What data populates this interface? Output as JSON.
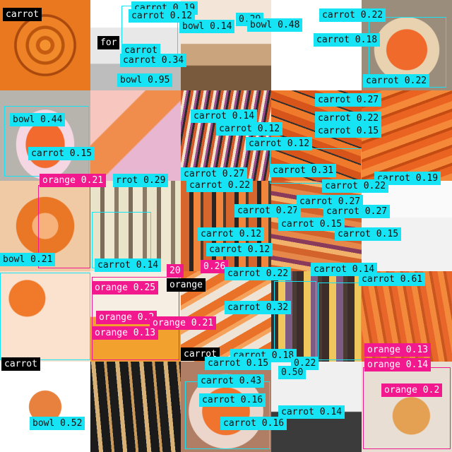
{
  "tiles": [
    {
      "name": "carrot-slices-tile",
      "bg": "radial-gradient(circle at 50% 50%, #f3922f 0 8%, #c85b12 9% 14%, #f08a2b 15% 25%, #b9540f 26% 30%, #ef8226 31% 44%, #a9490d 45% 48%, #e9781f 49% 100%)"
    },
    {
      "name": "cupcakes-tile",
      "bg": "linear-gradient(180deg,#f3e6d9 0 48%, #caa47c 49% 72%, #7a5a3c 73% 100%)"
    },
    {
      "name": "fork-tile",
      "bg": "linear-gradient(180deg,#ffffff 0 30%, #e8e8e8 31% 70%, #bdbdbd 71% 100%)"
    },
    {
      "name": "white-tile",
      "bg": "#ffffff"
    },
    {
      "name": "carrot-bowl-tile",
      "bg": "radial-gradient(circle at 50% 55%, #f06a2c 0 30%, #e8d2b0 31% 48%, #9a8d7b 49% 100%)"
    },
    {
      "name": "heart-bowl-tile",
      "bg": "radial-gradient(ellipse at 50% 60%, #f26a2d 0 30%, #f4d7e2 31% 45%, #b7b4ad 46% 100%)"
    },
    {
      "name": "lunchbox-tile",
      "bg": "linear-gradient(135deg,#f6c6bf 0 30%, #f08d4c 31% 55%, #e8b6d1 56% 100%)"
    },
    {
      "name": "julienne-tile",
      "bg": "repeating-linear-gradient(100deg,#d45a2a 0 4px,#f0e4cf 4px 8px,#9a4a8f 8px 11px,#2a2a2a 11px 14px)"
    },
    {
      "name": "carrot-pile-tile",
      "bg": "repeating-linear-gradient(20deg,#d7541b 0 10px,#f07a2b 10px 20px,#2f2f2f 20px 22px)"
    },
    {
      "name": "carrot-pile-right-tile",
      "bg": "repeating-linear-gradient(160deg,#ea6320 0 10px,#f5893a 10px 20px,#c44c12 20px 24px)"
    },
    {
      "name": "sliced-circle-tile",
      "bg": "radial-gradient(circle at 50% 50%, #f7b17a 0 20%, #e97725 21% 45%, #f0c9a5 46% 100%)"
    },
    {
      "name": "parsnip-tile",
      "bg": "repeating-linear-gradient(90deg,#e9e3c9 0 14px,#7c6b58 14px 20px,#efe7d0 20px 34px,#8a7a66 34px 40px)"
    },
    {
      "name": "grill-tile",
      "bg": "repeating-linear-gradient(90deg,#d6662b 0 12px,#2a2522 12px 18px,#f0853b 18px 28px,#4b3b2e 28px 32px)"
    },
    {
      "name": "mixed-carrots-tile",
      "bg": "repeating-linear-gradient(10deg,#d3632a 0 9px,#f2b16b 9px 16px,#8a3b5b 16px 22px,#e6884a 22px 30px)"
    },
    {
      "name": "hanging-carrots-tile",
      "bg": "linear-gradient(180deg,#fafafa 0 40%, #f2f2f2 41% 100%)"
    },
    {
      "name": "orange-slices-tile",
      "bg": "radial-gradient(circle at 30% 30%, #f0792a 0 20%, #fbe2cf 21% 100%)"
    },
    {
      "name": "carrot-juice-tile",
      "bg": "linear-gradient(180deg,#f6ede3 0 50%, #f2a12e 51% 100%)"
    },
    {
      "name": "cut-carrots-tile",
      "bg": "repeating-linear-gradient(150deg,#ea7128 0 12px,#f4a25c 12px 18px,#efe3d6 18px 30px)"
    },
    {
      "name": "purple-carrots-tile",
      "bg": "repeating-linear-gradient(90deg,#3d2d2a 0 10px,#f0c75c 10px 20px,#7d5b82 20px 30px,#4a3b35 30px 36px)"
    },
    {
      "name": "market-carrots-tile",
      "bg": "repeating-linear-gradient(80deg,#e9662a 0 8px,#f38a3b 8px 16px,#c9561f 16px 20px)"
    },
    {
      "name": "plate-tile",
      "bg": "radial-gradient(circle at 50% 50%, #e9813e 0 25%, #ffffff 26% 100%)"
    },
    {
      "name": "dark-carrots-tile",
      "bg": "repeating-linear-gradient(85deg,#1c1c1c 0 12px,#d8b177 12px 18px,#1a1a1a 18px 30px,#c99a5c 30px 34px)"
    },
    {
      "name": "bowl-carrots-tile",
      "bg": "radial-gradient(circle at 50% 55%, #f0742d 0 35%, #ecd6cc 36% 55%, #b07e64 56% 100%)"
    },
    {
      "name": "seedlings-tile",
      "bg": "linear-gradient(180deg,#f0f0f0 0 55%, #3b3b3b 56% 100%)"
    },
    {
      "name": "onion-tile",
      "bg": "radial-gradient(circle at 55% 60%, #e4a053 0 25%, #e8ded3 26% 100%)"
    }
  ],
  "boxes": [
    {
      "name": "detection-box",
      "c": "cyan"
    },
    {
      "name": "detection-box",
      "c": "cyan"
    },
    {
      "name": "detection-box",
      "c": "cyan"
    },
    {
      "name": "detection-box",
      "c": "cyan"
    },
    {
      "name": "detection-box",
      "c": "cyan"
    },
    {
      "name": "detection-box",
      "c": "cyan"
    },
    {
      "name": "detection-box",
      "c": "pink"
    },
    {
      "name": "detection-box",
      "c": "pink"
    },
    {
      "name": "detection-box",
      "c": "cyan"
    },
    {
      "name": "detection-box",
      "c": "cyan"
    },
    {
      "name": "detection-box",
      "c": "pink"
    },
    {
      "name": "detection-box",
      "c": "cyan"
    }
  ],
  "labels": [
    {
      "t": "carrot",
      "c": "black"
    },
    {
      "t": "carrot 0.19",
      "c": "cyan"
    },
    {
      "t": "carrot 0.12",
      "c": "cyan"
    },
    {
      "t": "0.29",
      "c": "cyan"
    },
    {
      "t": "bowl 0.14",
      "c": "cyan"
    },
    {
      "t": "bowl 0.48",
      "c": "cyan"
    },
    {
      "t": "carrot 0.22",
      "c": "cyan"
    },
    {
      "t": "carrot 0.18",
      "c": "cyan"
    },
    {
      "t": "for",
      "c": "black"
    },
    {
      "t": "carrot",
      "c": "cyan"
    },
    {
      "t": "carrot 0.34",
      "c": "cyan"
    },
    {
      "t": "bowl 0.95",
      "c": "cyan"
    },
    {
      "t": "carrot 0.22",
      "c": "cyan"
    },
    {
      "t": "carrot 0.27",
      "c": "cyan"
    },
    {
      "t": "carrot 0.14",
      "c": "cyan"
    },
    {
      "t": "bowl 0.44",
      "c": "cyan"
    },
    {
      "t": "carrot 0.12",
      "c": "cyan"
    },
    {
      "t": "carrot 0.22",
      "c": "cyan"
    },
    {
      "t": "carrot 0.15",
      "c": "cyan"
    },
    {
      "t": "carrot 0.12",
      "c": "cyan"
    },
    {
      "t": "carrot 0.15",
      "c": "cyan"
    },
    {
      "t": "carrot 0.31",
      "c": "cyan"
    },
    {
      "t": "carrot 0.19",
      "c": "cyan"
    },
    {
      "t": "orange 0.21",
      "c": "pink"
    },
    {
      "t": "rrot 0.29",
      "c": "cyan"
    },
    {
      "t": "carrot 0.27",
      "c": "cyan"
    },
    {
      "t": "carrot 0.22",
      "c": "cyan"
    },
    {
      "t": "carrot 0.22",
      "c": "cyan"
    },
    {
      "t": "carrot 0.27",
      "c": "cyan"
    },
    {
      "t": "carrot 0.27",
      "c": "cyan"
    },
    {
      "t": "carrot 0.27",
      "c": "cyan"
    },
    {
      "t": "carrot 0.15",
      "c": "cyan"
    },
    {
      "t": "carrot 0.12",
      "c": "cyan"
    },
    {
      "t": "carrot 0.15",
      "c": "cyan"
    },
    {
      "t": "carrot 0.12",
      "c": "cyan"
    },
    {
      "t": "bowl 0.21",
      "c": "cyan"
    },
    {
      "t": "carrot 0.14",
      "c": "cyan"
    },
    {
      "t": "20",
      "c": "pink"
    },
    {
      "t": "0.26",
      "c": "pink"
    },
    {
      "t": "carrot 0.22",
      "c": "cyan"
    },
    {
      "t": "carrot 0.14",
      "c": "cyan"
    },
    {
      "t": "carrot 0.61",
      "c": "cyan"
    },
    {
      "t": "orange 0.25",
      "c": "pink"
    },
    {
      "t": "orange",
      "c": "black"
    },
    {
      "t": "carrot 0.32",
      "c": "cyan"
    },
    {
      "t": "orange 0.2",
      "c": "pink"
    },
    {
      "t": "orange 0.21",
      "c": "pink"
    },
    {
      "t": "orange 0.13",
      "c": "pink"
    },
    {
      "t": "orange 0.13",
      "c": "pink"
    },
    {
      "t": "orange 0.14",
      "c": "pink"
    },
    {
      "t": "carrot",
      "c": "black"
    },
    {
      "t": "carrot",
      "c": "black"
    },
    {
      "t": "carrot 0.18",
      "c": "cyan"
    },
    {
      "t": "carrot 0.15",
      "c": "cyan"
    },
    {
      "t": "0.22",
      "c": "cyan"
    },
    {
      "t": "0.50",
      "c": "cyan"
    },
    {
      "t": "carrot 0.43",
      "c": "cyan"
    },
    {
      "t": "orange 0.2",
      "c": "pink"
    },
    {
      "t": "carrot 0.16",
      "c": "cyan"
    },
    {
      "t": "carrot 0.14",
      "c": "cyan"
    },
    {
      "t": "carrot 0.16",
      "c": "cyan"
    },
    {
      "t": "bowl 0.52",
      "c": "cyan"
    }
  ]
}
